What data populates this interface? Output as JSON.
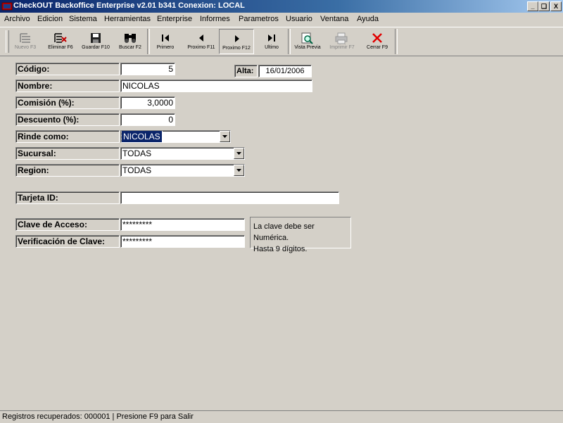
{
  "window": {
    "title": "CheckOUT Backoffice Enterprise v2.01 b341 Conexion: LOCAL",
    "buttons": [
      "_",
      "❏",
      "X"
    ]
  },
  "menu": [
    "Archivo",
    "Edicion",
    "Sistema",
    "Herramientas",
    "Enterprise",
    "Informes",
    "Parametros",
    "Usuario",
    "Ventana",
    "Ayuda"
  ],
  "toolbar": [
    {
      "label": "Nuevo F3",
      "icon": "new-icon",
      "enabled": false
    },
    {
      "label": "Eliminar F6",
      "icon": "delete-icon",
      "enabled": true
    },
    {
      "label": "Guardar F10",
      "icon": "save-icon",
      "enabled": true
    },
    {
      "label": "Buscar F2",
      "icon": "binoculars-icon",
      "enabled": true
    },
    {
      "label": "Primero",
      "icon": "first-icon",
      "enabled": true
    },
    {
      "label": "Proximo F11",
      "icon": "previous-icon",
      "enabled": true
    },
    {
      "label": "Proximo F12",
      "icon": "next-icon",
      "enabled": true
    },
    {
      "label": "Ultimo",
      "icon": "last-icon",
      "enabled": true
    },
    {
      "label": "Vista Previa",
      "icon": "preview-icon",
      "enabled": true
    },
    {
      "label": "Imprimir F7",
      "icon": "printer-icon",
      "enabled": false
    },
    {
      "label": "Cerrar F9",
      "icon": "close-icon",
      "enabled": true
    }
  ],
  "form": {
    "codigo_label": "Código:",
    "codigo_value": "5",
    "alta_label": "Alta:",
    "alta_value": "16/01/2006",
    "nombre_label": "Nombre:",
    "nombre_value": "NICOLAS",
    "comision_label": "Comisión (%):",
    "comision_value": "3,0000",
    "descuento_label": "Descuento (%):",
    "descuento_value": "0",
    "rinde_label": "Rinde como:",
    "rinde_value": "NICOLAS",
    "sucursal_label": "Sucursal:",
    "sucursal_value": "TODAS",
    "region_label": "Region:",
    "region_value": "TODAS",
    "tarjeta_label": "Tarjeta ID:",
    "tarjeta_value": "",
    "clave_label": "Clave de Acceso:",
    "clave_value": "*********",
    "verif_label": "Verificación de Clave:",
    "verif_value": "*********",
    "hint_line1": "La clave debe ser Numérica.",
    "hint_line2": "Hasta 9 dígitos."
  },
  "status": "Registros recuperados: 000001 | Presione F9 para Salir"
}
